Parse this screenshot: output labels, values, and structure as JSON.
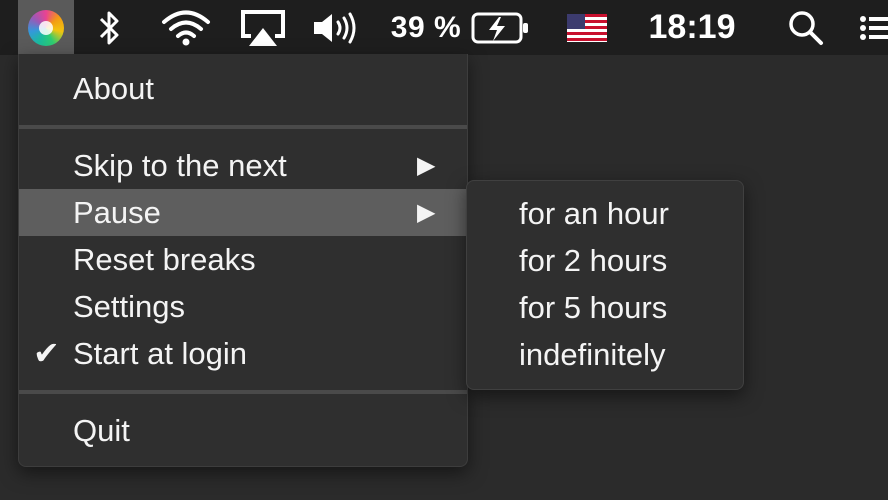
{
  "menubar": {
    "app_icon": "app-logo-icon",
    "icons": [
      "bluetooth-icon",
      "wifi-icon",
      "airplay-icon",
      "volume-icon",
      "battery-charging-icon",
      "us-flag-icon",
      "search-icon",
      "list-icon"
    ],
    "battery_percent": "39 %",
    "clock": "18:19"
  },
  "menu": {
    "items": [
      {
        "label": "About"
      },
      {
        "label": "Skip to the next",
        "arrow": "▶"
      },
      {
        "label": "Pause",
        "arrow": "▶"
      },
      {
        "label": "Reset breaks"
      },
      {
        "label": "Settings"
      },
      {
        "label": "Start at login",
        "check": "✔"
      },
      {
        "label": "Quit"
      }
    ],
    "highlighted": "Pause"
  },
  "submenu": {
    "items": [
      {
        "label": "for an hour"
      },
      {
        "label": "for 2 hours"
      },
      {
        "label": "for 5 hours"
      },
      {
        "label": "indefinitely"
      }
    ]
  },
  "colors": {
    "menubar_bg": "#1e1e1e",
    "menu_bg": "#2f2f2f",
    "highlight": "#5e5e5e",
    "text": "#f4f4f4"
  }
}
